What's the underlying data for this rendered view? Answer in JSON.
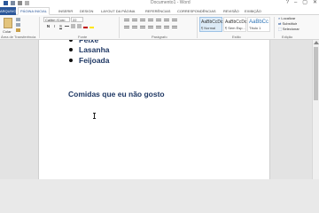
{
  "window": {
    "title": "Documento1 - Word",
    "controls": [
      "?",
      "–",
      "▢",
      "✕"
    ]
  },
  "tabs": [
    "ARQUIVO",
    "PÁGINA INICIAL",
    "INSERIR",
    "DESIGN",
    "LAYOUT DA PÁGINA",
    "REFERÊNCIAS",
    "CORRESPONDÊNCIAS",
    "REVISÃO",
    "EXIBIÇÃO"
  ],
  "ribbon": {
    "clipboard": {
      "paste_label": "Colar",
      "group_label": "Área de Transferência"
    },
    "font": {
      "font_name": "Calibri (Corp",
      "font_size": "22",
      "bold": "N",
      "italic": "I",
      "underline": "S",
      "group_label": "Fonte"
    },
    "paragraph": {
      "group_label": "Parágrafo"
    },
    "styles": {
      "items": [
        {
          "preview": "AaBbCcDc",
          "name": "¶ Normal"
        },
        {
          "preview": "AaBbCcDc",
          "name": "¶ Sem Esp..."
        },
        {
          "preview": "AaBbCc",
          "name": "Título 1"
        }
      ],
      "group_label": "Estilo"
    },
    "editing": {
      "items": [
        "Localizar",
        "Substituir",
        "Selecionar"
      ],
      "group_label": "Edição"
    }
  },
  "document": {
    "bullets": [
      "Peixe",
      "Lasanha",
      "Feijoada"
    ],
    "heading": "Comidas que eu não gosto"
  }
}
